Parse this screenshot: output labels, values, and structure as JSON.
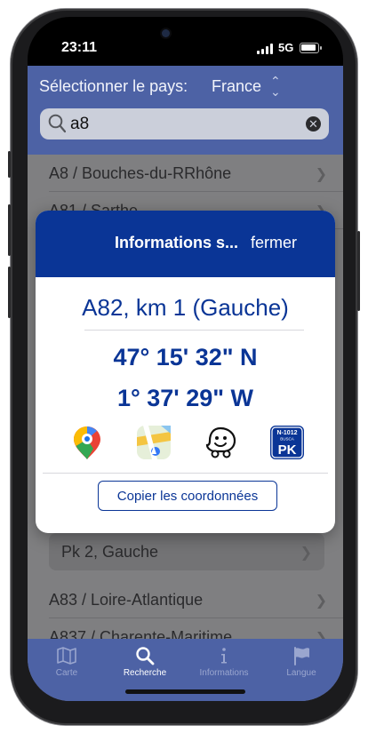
{
  "status_bar": {
    "time": "23:11",
    "network": "5G"
  },
  "header": {
    "country_label": "Sélectionner le pays:",
    "country_value": "France"
  },
  "search": {
    "value": "a8"
  },
  "list": {
    "rows": [
      {
        "label": "A8 / Bouches-du-RRhône"
      },
      {
        "label": "A81 / Sarthe"
      },
      {
        "label": "Pk 2, Gauche"
      },
      {
        "label": "A83 / Loire-Atlantique"
      },
      {
        "label": "A837 / Charente-Maritime"
      }
    ]
  },
  "modal": {
    "title": "Informations s...",
    "close_label": "fermer",
    "pk_title": "A82, km 1 (Gauche)",
    "latitude": "47° 15' 32\" N",
    "longitude": "1° 37' 29\" W",
    "apps": [
      {
        "name": "Google Maps",
        "icon": "google-maps-icon"
      },
      {
        "name": "Apple Plans",
        "icon": "apple-maps-icon"
      },
      {
        "name": "Waze",
        "icon": "waze-icon"
      },
      {
        "name": "Busca PK",
        "icon": "busca-pk-icon",
        "badge_top": "N-1012",
        "badge_mid": "BUSCA",
        "badge_main": "PK"
      }
    ],
    "copy_button": "Copier les coordonnées"
  },
  "tabbar": {
    "tabs": [
      {
        "label": "Carte",
        "icon": "map-icon"
      },
      {
        "label": "Recherche",
        "icon": "search-icon",
        "active": true
      },
      {
        "label": "Informations",
        "icon": "info-icon"
      },
      {
        "label": "Langue",
        "icon": "flag-icon"
      }
    ]
  },
  "colors": {
    "header_blue": "#4d62a5",
    "modal_blue": "#0a3596",
    "overlay_gray": "#7f7f81"
  }
}
